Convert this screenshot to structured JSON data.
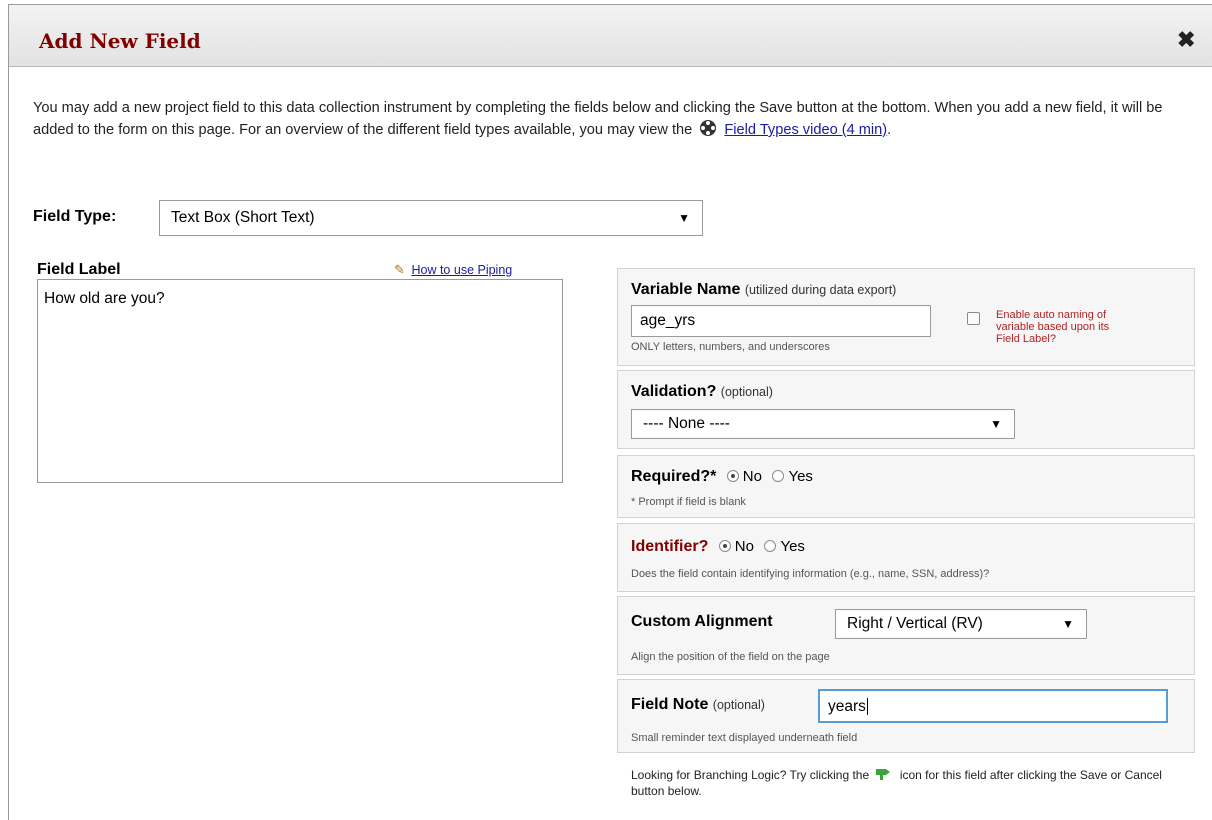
{
  "dialog": {
    "title": "Add New Field",
    "close_glyph": "✖"
  },
  "intro": {
    "text_1": "You may add a new project field to this data collection instrument by completing the fields below and clicking the Save button at the bottom. When you add a new field, it will be added to the form on this page. For an overview of the different field types available, you may view the",
    "video_link": "Field Types video (4 min)",
    "text_2": "."
  },
  "field_type": {
    "label": "Field Type:",
    "value": "Text Box (Short Text)"
  },
  "field_label": {
    "label": "Field Label",
    "piping_link": "How to use Piping",
    "value": "How old are you?"
  },
  "variable_name": {
    "heading": "Variable Name",
    "heading_note": "(utilized during data export)",
    "value": "age_yrs",
    "hint": "ONLY letters, numbers, and underscores",
    "auto_naming_line_1": "Enable auto naming of",
    "auto_naming_line_2": "variable based upon its",
    "auto_naming_line_3": "Field Label?"
  },
  "validation": {
    "heading": "Validation?",
    "heading_note": "(optional)",
    "value": "---- None ----"
  },
  "required": {
    "heading": "Required?*",
    "option_no": "No",
    "option_yes": "Yes",
    "selected": "No",
    "hint": "* Prompt if field is blank"
  },
  "identifier": {
    "heading": "Identifier?",
    "option_no": "No",
    "option_yes": "Yes",
    "selected": "No",
    "hint": "Does the field contain identifying information (e.g., name, SSN, address)?"
  },
  "custom_alignment": {
    "heading": "Custom Alignment",
    "value": "Right / Vertical (RV)",
    "hint": "Align the position of the field on the page"
  },
  "field_note": {
    "heading": "Field Note",
    "heading_note": "(optional)",
    "value": "years",
    "hint": "Small reminder text displayed underneath field"
  },
  "branching": {
    "text_1": "Looking for Branching Logic? Try clicking the",
    "text_2": "icon for this field after clicking the Save or Cancel button below."
  },
  "colors": {
    "title": "#800000",
    "link": "#1a1aa6",
    "warning": "#b22222",
    "focus_border": "#5b9bd5"
  },
  "icons": {
    "close": "close-icon",
    "film": "film-reel-icon",
    "pencil": "pencil-icon",
    "branching": "branching-logic-icon",
    "dropdown": "chevron-down-icon"
  }
}
